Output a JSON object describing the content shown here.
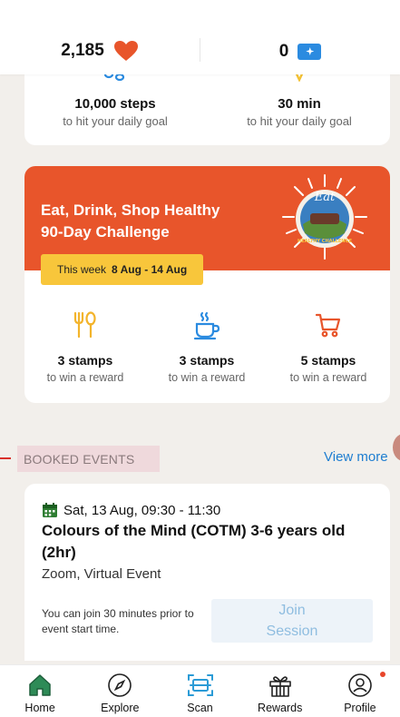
{
  "top_bar": {
    "hearts_value": "2,185",
    "tickets_value": "0"
  },
  "goals": [
    {
      "value": "10,000 steps",
      "caption": "to hit your daily goal",
      "icon": "steps-icon"
    },
    {
      "value": "30 min",
      "caption": "to hit your daily goal",
      "icon": "activity-icon"
    }
  ],
  "challenge": {
    "title_line1": "Eat, Drink, Shop Healthy",
    "title_line2": "90-Day Challenge",
    "week_prefix": "This week",
    "week_range": "8 Aug - 14 Aug",
    "badge_top": "Eat",
    "badge_bottom": "HEALTHY CHALLENGE",
    "stamps": [
      {
        "value": "3 stamps",
        "caption": "to win a reward",
        "icon": "utensils-icon"
      },
      {
        "value": "3 stamps",
        "caption": "to win a reward",
        "icon": "cup-icon"
      },
      {
        "value": "5 stamps",
        "caption": "to win a reward",
        "icon": "cart-icon"
      }
    ]
  },
  "booked_events": {
    "section_label": "BOOKED EVENTS",
    "view_more": "View more",
    "event": {
      "date": "Sat, 13 Aug, 09:30 - 11:30",
      "title": "Colours of the Mind (COTM) 3-6 years old (2hr)",
      "location": "Zoom, Virtual Event",
      "note": "You can join 30 minutes prior to event start time.",
      "join_line1": "Join",
      "join_line2": "Session"
    }
  },
  "colors": {
    "accent_orange": "#e8552b",
    "pill_yellow": "#f8c63b",
    "link_blue": "#1e7dd0",
    "home_green": "#2e8b57"
  },
  "nav": [
    {
      "label": "Home",
      "icon": "home-icon"
    },
    {
      "label": "Explore",
      "icon": "compass-icon"
    },
    {
      "label": "Scan",
      "icon": "scan-icon"
    },
    {
      "label": "Rewards",
      "icon": "gift-icon"
    },
    {
      "label": "Profile",
      "icon": "profile-icon"
    }
  ]
}
